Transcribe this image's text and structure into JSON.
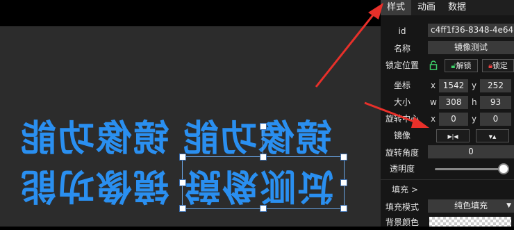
{
  "tabs": [
    "样式",
    "动画",
    "数据"
  ],
  "canvas_text": {
    "line1": "镜像功能",
    "line2": "镜像功能",
    "line3": "镜像测试"
  },
  "panel": {
    "id_label": "id",
    "id_value": "c4ff1f36-8348-4e64",
    "name_label": "名称",
    "name_value": "镜像测试",
    "lock_label": "锁定位置",
    "unlock_btn": "解锁",
    "lock_btn": "锁定",
    "coord_label": "坐标",
    "x_label": "x",
    "x_value": "1542",
    "y_label": "y",
    "y_value": "252",
    "size_label": "大小",
    "w_label": "w",
    "w_value": "308",
    "h_label": "h",
    "h_value": "93",
    "rotcenter_label": "旋转中心",
    "rc_x_label": "x",
    "rc_x_value": "0",
    "rc_y_label": "y",
    "rc_y_value": "0",
    "mirror_label": "镜像",
    "mirror_h_icon": "▶|◀",
    "mirror_v_icon": "▼▲",
    "rot_label": "旋转角度",
    "rot_value": "0",
    "opacity_label": "透明度",
    "opacity_level": 1.0,
    "fill_section": "填充 >",
    "fill_mode_label": "填充模式",
    "fill_mode_value": "纯色填充",
    "bg_label": "背景颜色"
  },
  "colors": {
    "accent": "#2a8ff0",
    "arrow": "#e8302a",
    "lock_green": "#3fd16a",
    "lock_red": "#e84040"
  }
}
